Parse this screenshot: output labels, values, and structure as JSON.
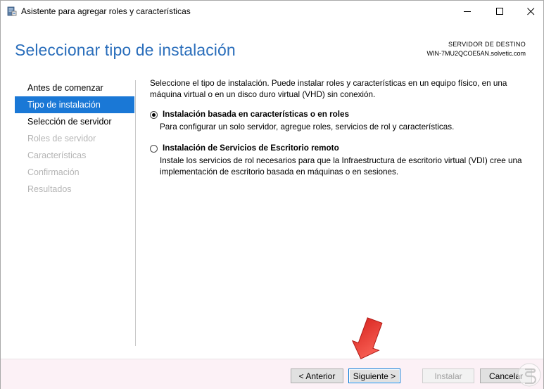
{
  "window": {
    "title": "Asistente para agregar roles y características"
  },
  "header": {
    "title": "Seleccionar tipo de instalación",
    "destination_label": "SERVIDOR DE DESTINO",
    "destination_server": "WIN-7MU2QCOE5AN.solvetic.com"
  },
  "sidebar": {
    "items": [
      {
        "label": "Antes de comenzar",
        "state": "normal"
      },
      {
        "label": "Tipo de instalación",
        "state": "active"
      },
      {
        "label": "Selección de servidor",
        "state": "normal"
      },
      {
        "label": "Roles de servidor",
        "state": "disabled"
      },
      {
        "label": "Características",
        "state": "disabled"
      },
      {
        "label": "Confirmación",
        "state": "disabled"
      },
      {
        "label": "Resultados",
        "state": "disabled"
      }
    ]
  },
  "main": {
    "intro": "Seleccione el tipo de instalación. Puede instalar roles y características en un equipo físico, en una máquina virtual o en un disco duro virtual (VHD) sin conexión.",
    "options": [
      {
        "title": "Instalación basada en características o en roles",
        "description": "Para configurar un solo servidor, agregue roles, servicios de rol y características.",
        "selected": true
      },
      {
        "title": "Instalación de Servicios de Escritorio remoto",
        "description": "Instale los servicios de rol necesarios para que la Infraestructura de escritorio virtual (VDI) cree una implementación de escritorio basada en máquinas o en sesiones.",
        "selected": false
      }
    ]
  },
  "footer": {
    "back_label": "< Anterior",
    "next_label": "Siguiente >",
    "install_label": "Instalar",
    "cancel_label": "Cancelar"
  },
  "colors": {
    "accent": "#1a78d6",
    "title_blue": "#2a6ebb",
    "arrow_red": "#e8332f",
    "footer_bg": "#fcf1f6"
  },
  "icons": {
    "app": "server-manager-icon",
    "minimize": "minimize-icon",
    "maximize": "maximize-icon",
    "close": "close-icon",
    "annotation": "red-arrow-icon"
  }
}
